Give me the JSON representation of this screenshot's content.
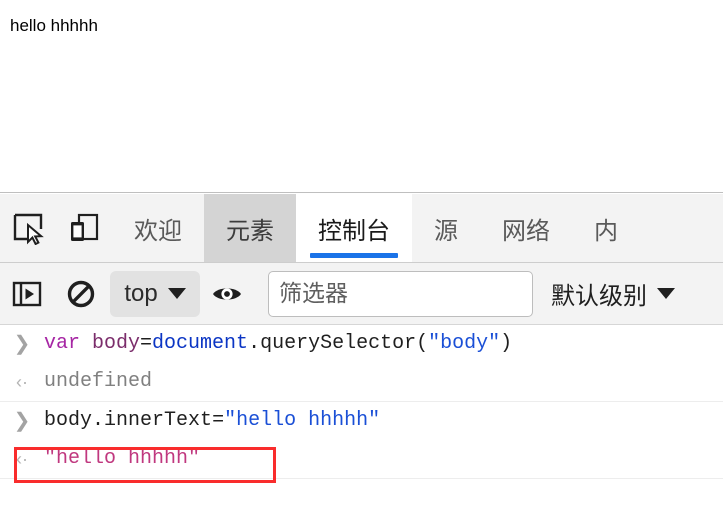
{
  "page": {
    "body_text": "hello hhhhh"
  },
  "devtools": {
    "tabbar": {
      "inspect_icon": "inspect-element-icon",
      "device_icon": "device-toolbar-icon",
      "tabs": [
        {
          "label": "欢迎",
          "state": "normal"
        },
        {
          "label": "元素",
          "state": "hovered"
        },
        {
          "label": "控制台",
          "state": "active"
        },
        {
          "label": "源",
          "state": "normal"
        },
        {
          "label": "网络",
          "state": "normal"
        },
        {
          "label": "内",
          "state": "normal"
        }
      ],
      "active_underline_color": "#1a73e8"
    },
    "console_toolbar": {
      "sidebar_toggle_icon": "console-sidebar-toggle-icon",
      "clear_icon": "clear-console-icon",
      "context": {
        "value": "top",
        "caret": "chevron-down-icon"
      },
      "eye_icon": "live-expression-eye-icon",
      "filter": {
        "value": "",
        "placeholder": "筛选器"
      },
      "levels": {
        "value": "默认级别",
        "caret": "chevron-down-icon"
      }
    },
    "console_messages": [
      {
        "kind": "input",
        "gutter": "❯",
        "tokens": [
          {
            "text": "var ",
            "cls": "tok-kw"
          },
          {
            "text": "body",
            "cls": "tok-var"
          },
          {
            "text": "=",
            "cls": "tok-op"
          },
          {
            "text": "document",
            "cls": "tok-obj"
          },
          {
            "text": ".",
            "cls": "tok-op"
          },
          {
            "text": "querySelector",
            "cls": "tok-prop"
          },
          {
            "text": "(",
            "cls": "tok-op"
          },
          {
            "text": "\"body\"",
            "cls": "tok-str"
          },
          {
            "text": ")",
            "cls": "tok-op"
          }
        ],
        "plain": "var body=document.querySelector(\"body\")"
      },
      {
        "kind": "output",
        "gutter": "‹·",
        "tokens": [
          {
            "text": "undefined",
            "cls": "res-undef"
          }
        ],
        "plain": "undefined",
        "divider": true
      },
      {
        "kind": "input",
        "gutter": "❯",
        "tokens": [
          {
            "text": "body",
            "cls": "tok-plain"
          },
          {
            "text": ".",
            "cls": "tok-op"
          },
          {
            "text": "innerText",
            "cls": "tok-plain"
          },
          {
            "text": "=",
            "cls": "tok-op"
          },
          {
            "text": "\"hello hhhhh\"",
            "cls": "tok-str"
          }
        ],
        "plain": "body.innerText=\"hello hhhhh\""
      },
      {
        "kind": "output",
        "gutter": "‹·",
        "tokens": [
          {
            "text": "\"hello hhhhh\"",
            "cls": "res-str"
          }
        ],
        "plain": "\"hello hhhhh\"",
        "highlighted": true,
        "highlight_color": "#f92c2c",
        "divider": true
      }
    ]
  }
}
